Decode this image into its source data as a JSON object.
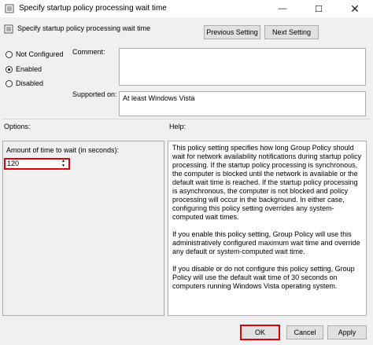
{
  "window": {
    "title": "Specify startup policy processing wait time",
    "controls": {
      "minimize": "—",
      "maximize": "☐",
      "close": "✕"
    }
  },
  "header": {
    "policy_name": "Specify startup policy processing wait time",
    "previous_label": "Previous Setting",
    "next_label": "Next Setting"
  },
  "state": {
    "options": [
      {
        "label": "Not Configured",
        "checked": false
      },
      {
        "label": "Enabled",
        "checked": true
      },
      {
        "label": "Disabled",
        "checked": false
      }
    ]
  },
  "comment": {
    "label": "Comment:",
    "value": ""
  },
  "supported": {
    "label": "Supported on:",
    "value": "At least Windows Vista"
  },
  "options_label": "Options:",
  "help_label": "Help:",
  "options": {
    "amount_label": "Amount of time to wait (in seconds):",
    "amount_value": "120"
  },
  "help": {
    "paragraphs": [
      "This policy setting specifies how long Group Policy should wait for network availability notifications during startup policy processing. If the startup policy processing is synchronous, the computer is blocked until the network is available or the default wait time is reached. If the startup policy processing is asynchronous, the computer is not blocked and policy processing will occur in the background. In either case, configuring this policy setting overrides any system-computed wait times.",
      "If you enable this policy setting, Group Policy will use this administratively configured maximum wait time and override any default or system-computed wait time.",
      "If you disable or do not configure this policy setting, Group Policy will use the default wait time of 30 seconds on computers running Windows Vista operating system."
    ]
  },
  "footer": {
    "ok_label": "OK",
    "cancel_label": "Cancel",
    "apply_label": "Apply"
  },
  "colors": {
    "highlight": "#e0000b",
    "background": "#f0f0f0"
  }
}
